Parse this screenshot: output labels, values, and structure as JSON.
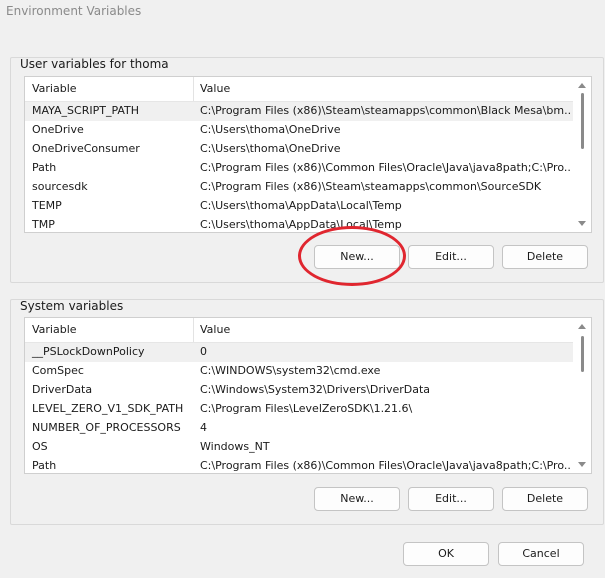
{
  "window": {
    "title": "Environment Variables"
  },
  "user_vars": {
    "group_label": "User variables for thoma",
    "columns": [
      "Variable",
      "Value"
    ],
    "rows": [
      {
        "name": "MAYA_SCRIPT_PATH",
        "value": "C:\\Program Files (x86)\\Steam\\steamapps\\common\\Black Mesa\\bm..."
      },
      {
        "name": "OneDrive",
        "value": "C:\\Users\\thoma\\OneDrive"
      },
      {
        "name": "OneDriveConsumer",
        "value": "C:\\Users\\thoma\\OneDrive"
      },
      {
        "name": "Path",
        "value": "C:\\Program Files (x86)\\Common Files\\Oracle\\Java\\java8path;C:\\Pro..."
      },
      {
        "name": "sourcesdk",
        "value": "C:\\Program Files (x86)\\Steam\\steamapps\\common\\SourceSDK"
      },
      {
        "name": "TEMP",
        "value": "C:\\Users\\thoma\\AppData\\Local\\Temp"
      },
      {
        "name": "TMP",
        "value": "C:\\Users\\thoma\\AppData\\Local\\Temp"
      }
    ],
    "buttons": {
      "new": "New...",
      "edit": "Edit...",
      "delete": "Delete"
    }
  },
  "system_vars": {
    "group_label": "System variables",
    "columns": [
      "Variable",
      "Value"
    ],
    "rows": [
      {
        "name": "__PSLockDownPolicy",
        "value": "0"
      },
      {
        "name": "ComSpec",
        "value": "C:\\WINDOWS\\system32\\cmd.exe"
      },
      {
        "name": "DriverData",
        "value": "C:\\Windows\\System32\\Drivers\\DriverData"
      },
      {
        "name": "LEVEL_ZERO_V1_SDK_PATH",
        "value": "C:\\Program Files\\LevelZeroSDK\\1.21.6\\"
      },
      {
        "name": "NUMBER_OF_PROCESSORS",
        "value": "4"
      },
      {
        "name": "OS",
        "value": "Windows_NT"
      },
      {
        "name": "Path",
        "value": "C:\\Program Files (x86)\\Common Files\\Oracle\\Java\\java8path;C:\\Pro..."
      }
    ],
    "buttons": {
      "new": "New...",
      "edit": "Edit...",
      "delete": "Delete"
    }
  },
  "footer": {
    "ok": "OK",
    "cancel": "Cancel"
  },
  "annotation": {
    "color": "#e0262f",
    "shape": "ellipse",
    "target": "user-new-button"
  }
}
